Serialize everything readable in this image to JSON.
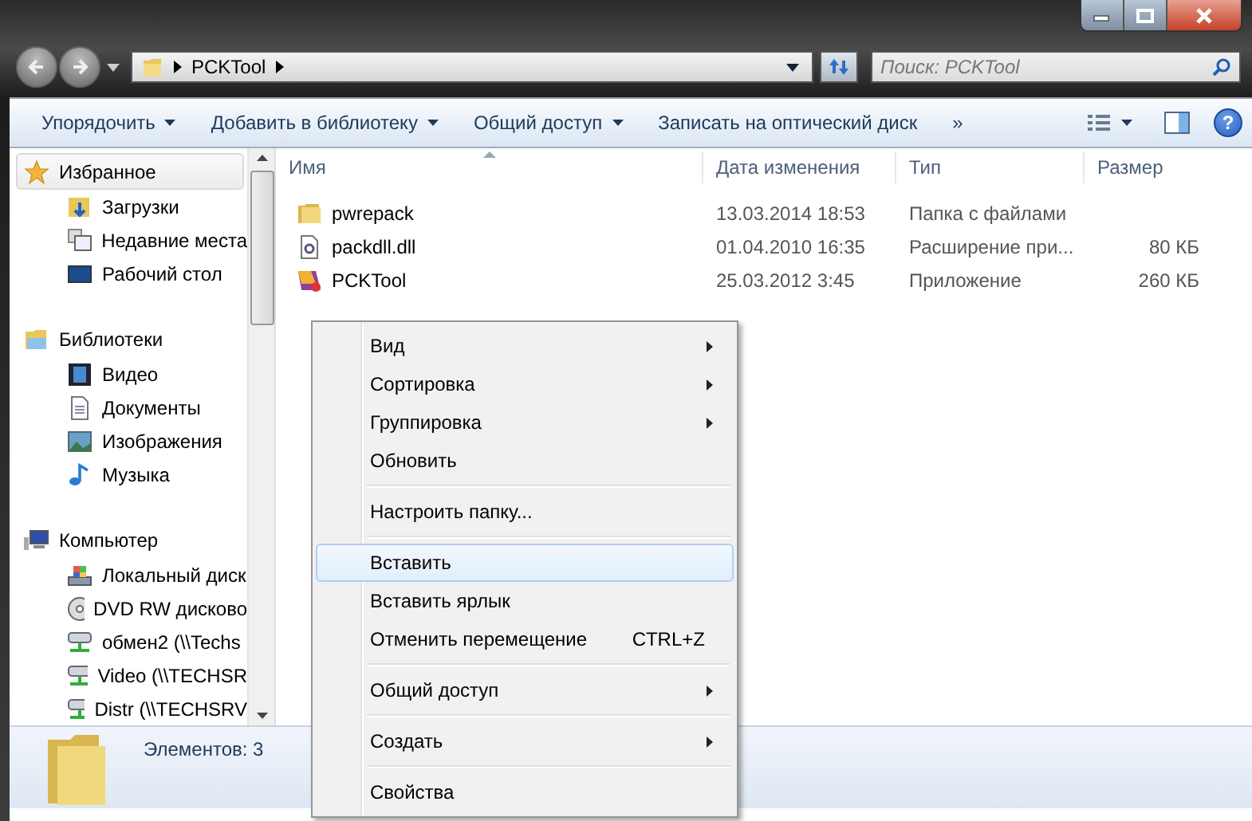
{
  "address_bar": {
    "crumbs": [
      "PCKTool"
    ]
  },
  "search": {
    "placeholder": "Поиск: PCKTool"
  },
  "toolbar": {
    "buttons": [
      {
        "label": "Упорядочить",
        "dropdown": true
      },
      {
        "label": "Добавить в библиотеку",
        "dropdown": true
      },
      {
        "label": "Общий доступ",
        "dropdown": true
      },
      {
        "label": "Записать на оптический диск",
        "dropdown": false
      }
    ],
    "overflow": "»",
    "help": "?"
  },
  "sidebar": {
    "groups": [
      {
        "label": "Избранное",
        "selected": true,
        "children": [
          {
            "label": "Загрузки"
          },
          {
            "label": "Недавние места"
          },
          {
            "label": "Рабочий стол"
          }
        ]
      },
      {
        "label": "Библиотеки",
        "selected": false,
        "children": [
          {
            "label": "Видео"
          },
          {
            "label": "Документы"
          },
          {
            "label": "Изображения"
          },
          {
            "label": "Музыка"
          }
        ]
      },
      {
        "label": "Компьютер",
        "selected": false,
        "children": [
          {
            "label": "Локальный диск"
          },
          {
            "label": "DVD RW дисково"
          },
          {
            "label": "обмен2 (\\\\Techs"
          },
          {
            "label": "Video (\\\\TECHSR"
          },
          {
            "label": "Distr (\\\\TECHSRV"
          }
        ]
      }
    ]
  },
  "table": {
    "columns": [
      {
        "label": "Имя",
        "sorted": true
      },
      {
        "label": "Дата изменения",
        "sorted": false
      },
      {
        "label": "Тип",
        "sorted": false
      },
      {
        "label": "Размер",
        "sorted": false
      }
    ],
    "rows": [
      {
        "kind": "folder",
        "name": "pwrepack",
        "date": "13.03.2014 18:53",
        "type": "Папка с файлами"
      },
      {
        "kind": "dll",
        "name": "packdll.dll",
        "date": "01.04.2010 16:35",
        "type": "Расширение при...",
        "size": "80 КБ"
      },
      {
        "kind": "app",
        "name": "PCKTool",
        "date": "25.03.2012 3:45",
        "type": "Приложение",
        "size": "260 КБ"
      }
    ]
  },
  "context_menu": {
    "items": [
      {
        "kind": "item",
        "label": "Вид",
        "submenu": true,
        "selected": false
      },
      {
        "kind": "item",
        "label": "Сортировка",
        "submenu": true,
        "selected": false
      },
      {
        "kind": "item",
        "label": "Группировка",
        "submenu": true,
        "selected": false
      },
      {
        "kind": "item",
        "label": "Обновить",
        "submenu": false,
        "selected": false
      },
      {
        "kind": "separator"
      },
      {
        "kind": "item",
        "label": "Настроить папку...",
        "submenu": false,
        "selected": false
      },
      {
        "kind": "separator"
      },
      {
        "kind": "item",
        "label": "Вставить",
        "submenu": false,
        "selected": true
      },
      {
        "kind": "item",
        "label": "Вставить ярлык",
        "submenu": false,
        "selected": false
      },
      {
        "kind": "item",
        "label": "Отменить перемещение",
        "shortcut": "CTRL+Z",
        "submenu": false,
        "selected": false
      },
      {
        "kind": "separator"
      },
      {
        "kind": "item",
        "label": "Общий доступ",
        "submenu": true,
        "selected": false
      },
      {
        "kind": "separator"
      },
      {
        "kind": "item",
        "label": "Создать",
        "submenu": true,
        "selected": false
      },
      {
        "kind": "separator"
      },
      {
        "kind": "item",
        "label": "Свойства",
        "submenu": false,
        "selected": false
      }
    ]
  },
  "status_bar": {
    "text": "Элементов: 3"
  }
}
